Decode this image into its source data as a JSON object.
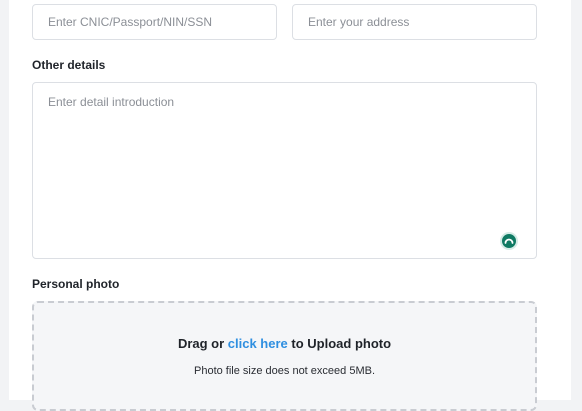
{
  "form": {
    "id_placeholder": "Enter CNIC/Passport/NIN/SSN",
    "address_placeholder": "Enter your address",
    "other_details_label": "Other details",
    "other_details_placeholder": "Enter detail introduction",
    "personal_photo_label": "Personal photo"
  },
  "upload": {
    "prefix": "Drag or ",
    "link": "click here",
    "suffix": " to Upload photo",
    "note": "Photo file size does not exceed 5MB."
  },
  "icons": {
    "assistant": "grammar-assistant-icon"
  },
  "colors": {
    "link": "#2f8fe0",
    "assistant": "#0f7a63"
  }
}
